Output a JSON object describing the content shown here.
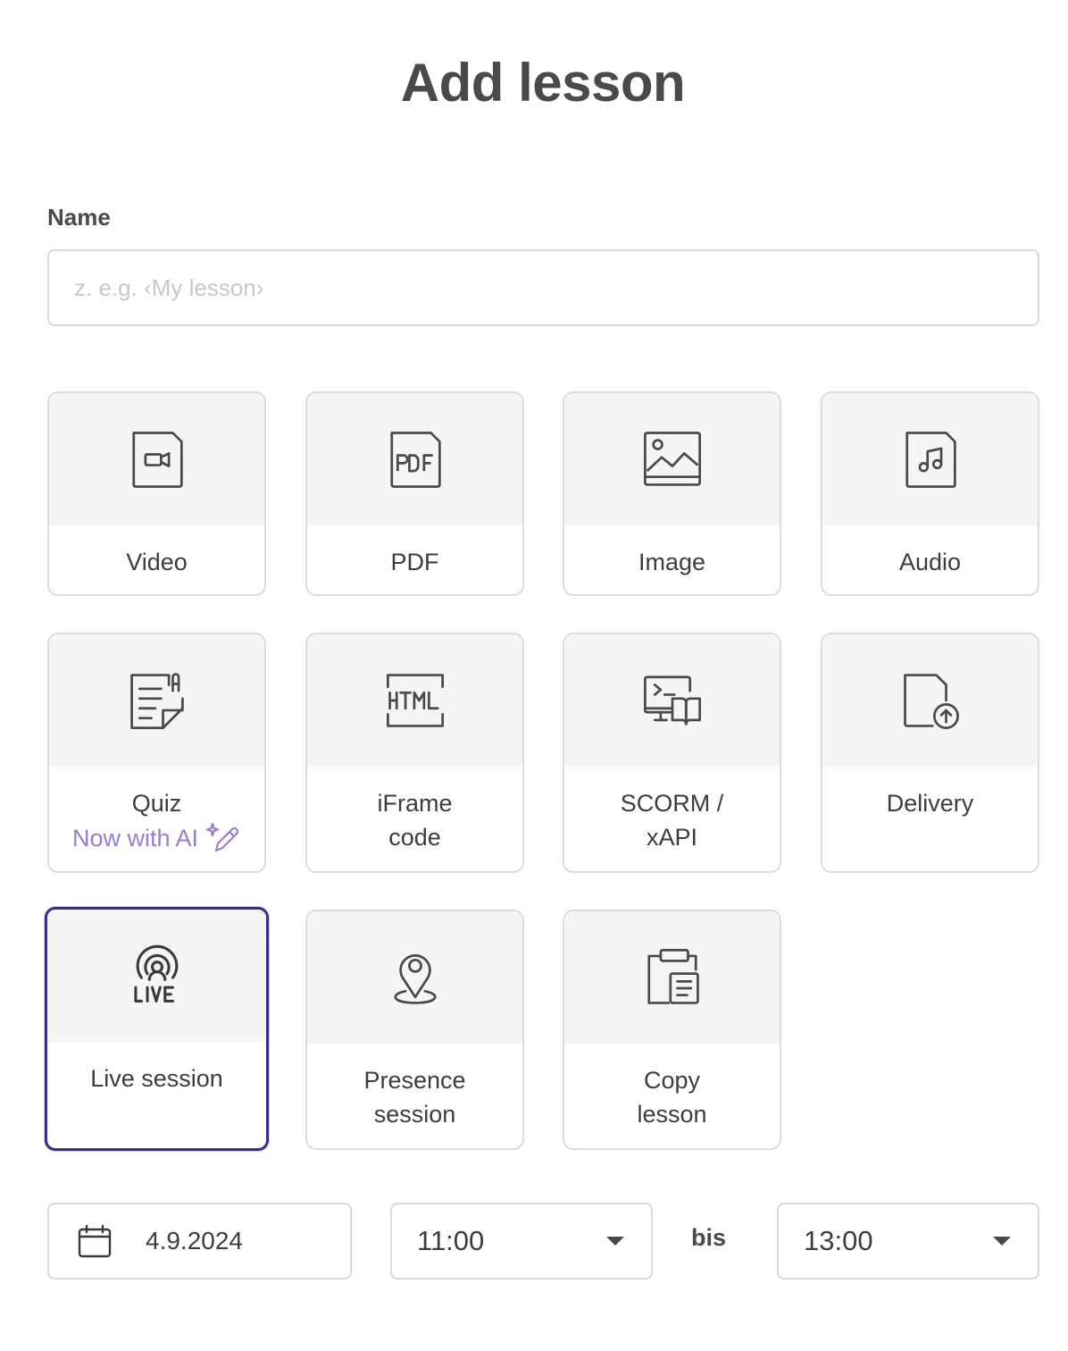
{
  "page": {
    "title": "Add lesson"
  },
  "name_field": {
    "label": "Name",
    "placeholder": "z. e.g. ‹My lesson›",
    "value": ""
  },
  "lesson_types": [
    {
      "label": "Video",
      "icon": "video-file-icon"
    },
    {
      "label": "PDF",
      "icon": "pdf-file-icon"
    },
    {
      "label": "Image",
      "icon": "image-icon"
    },
    {
      "label": "Audio",
      "icon": "audio-file-icon"
    },
    {
      "label": "Quiz",
      "sub": "Now with AI",
      "icon": "quiz-icon",
      "sub_icon": "ai-pen-sparkle-icon"
    },
    {
      "label_lines": [
        "iFrame",
        "code"
      ],
      "icon": "html-icon"
    },
    {
      "label_lines": [
        "SCORM /",
        "xAPI"
      ],
      "icon": "scorm-icon"
    },
    {
      "label": "Delivery",
      "icon": "file-upload-icon"
    },
    {
      "label": "Live session",
      "icon": "live-broadcast-icon",
      "selected": true
    },
    {
      "label_lines": [
        "Presence",
        "session"
      ],
      "icon": "location-pin-icon"
    },
    {
      "label_lines": [
        "Copy",
        "lesson"
      ],
      "icon": "clipboard-copy-icon"
    }
  ],
  "schedule": {
    "date": "4.9.2024",
    "start_time": "11:00",
    "separator": "bis",
    "end_time": "13:00"
  },
  "colors": {
    "accent": "#3b2f85",
    "ai": "#9b7bd4",
    "tile_bg": "#f5f5f5",
    "border": "#dcdcdc"
  }
}
